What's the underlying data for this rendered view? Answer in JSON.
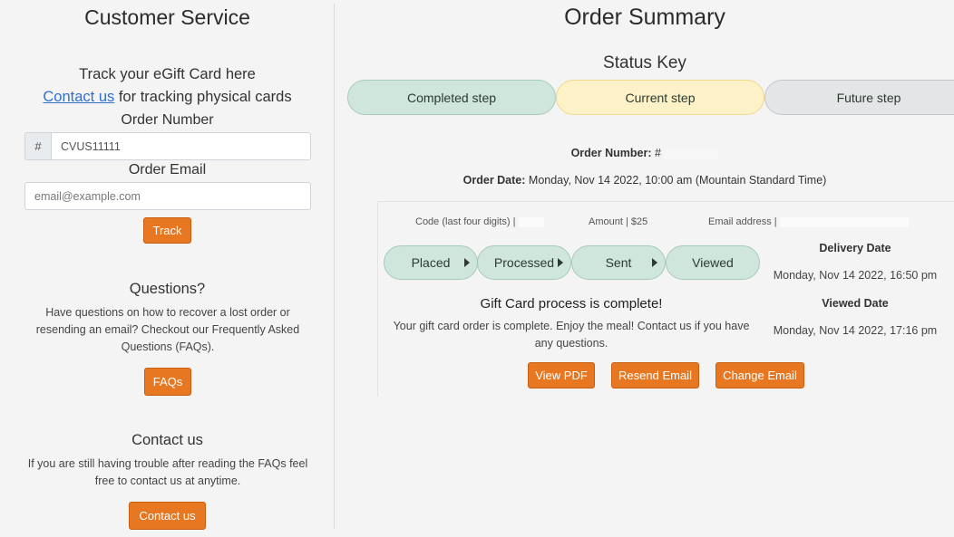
{
  "customer_service": {
    "title": "Customer Service",
    "track_line": "Track your eGift Card here",
    "contact_link": "Contact us",
    "contact_suffix": " for tracking physical cards",
    "order_number_label": "Order Number",
    "order_number_prefix": "#",
    "order_number_value": "CVUS11111",
    "order_email_label": "Order Email",
    "order_email_placeholder": "email@example.com",
    "track_button": "Track"
  },
  "questions": {
    "title": "Questions?",
    "text": "Have questions on how to recover a lost order or resending an email? Checkout our Frequently Asked Questions (FAQs).",
    "button": "FAQs"
  },
  "contact": {
    "title": "Contact us",
    "text": "If you are still having trouble after reading the FAQs feel free to contact us at anytime.",
    "button": "Contact us"
  },
  "order_summary": {
    "title": "Order Summary",
    "status_key_title": "Status Key",
    "status_key": {
      "completed": "Completed step",
      "current": "Current step",
      "future": "Future step"
    },
    "order_number_label": "Order Number:",
    "order_number_prefix": "#",
    "order_date_label": "Order Date:",
    "order_date_value": "Monday, Nov 14 2022, 10:00 am (Mountain Standard Time)"
  },
  "card": {
    "code_label": "Code (last four digits) |",
    "amount_label": "Amount | $25",
    "email_label": "Email address |",
    "steps": {
      "placed": "Placed",
      "processed": "Processed",
      "sent": "Sent",
      "viewed": "Viewed"
    },
    "delivery_date_label": "Delivery Date",
    "delivery_date_value": "Monday, Nov 14 2022, 16:50 pm",
    "viewed_date_label": "Viewed Date",
    "viewed_date_value": "Monday, Nov 14 2022, 17:16 pm",
    "complete_title": "Gift Card process is complete!",
    "complete_text": "Your gift card order is complete. Enjoy the meal! Contact us if you have any questions.",
    "buttons": {
      "view_pdf": "View PDF",
      "resend_email": "Resend Email",
      "change_email": "Change Email"
    }
  },
  "colors": {
    "accent": "#e87722",
    "completed": "#cfe6dc",
    "current": "#fdf1c8",
    "future": "#e4e5e6",
    "link": "#2f6fd0"
  }
}
